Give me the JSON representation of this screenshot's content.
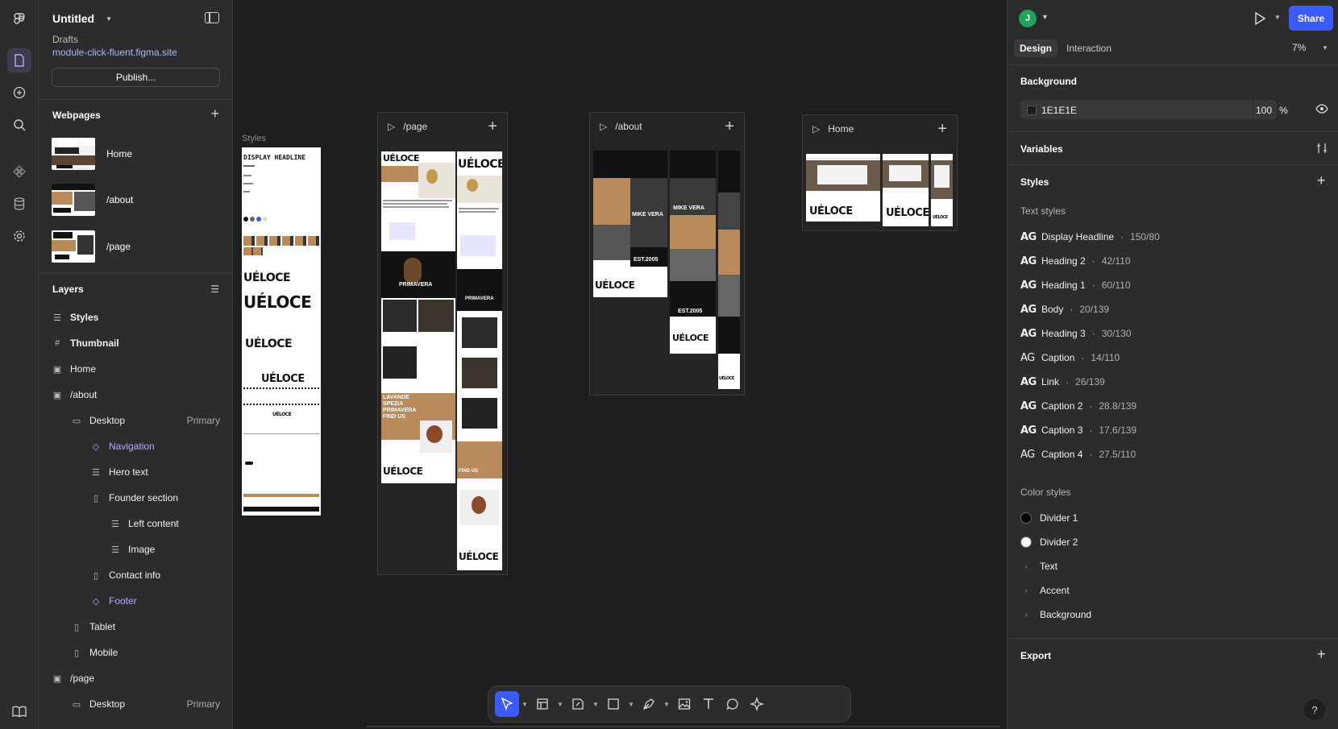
{
  "file": {
    "title": "Untitled",
    "drafts": "Drafts",
    "site": "module-click-fluent.figma.site",
    "publish_label": "Publish..."
  },
  "webpages": {
    "header": "Webpages",
    "items": [
      {
        "label": "Home"
      },
      {
        "label": "/about"
      },
      {
        "label": "/page"
      }
    ]
  },
  "layers": {
    "header": "Layers",
    "items": [
      {
        "label": "Styles"
      },
      {
        "label": "Thumbnail"
      },
      {
        "label": "Home"
      },
      {
        "label": "/about"
      },
      {
        "label": "Desktop",
        "badge": "Primary"
      },
      {
        "label": "Navigation"
      },
      {
        "label": "Hero text"
      },
      {
        "label": "Founder section"
      },
      {
        "label": "Left content"
      },
      {
        "label": "Image"
      },
      {
        "label": "Contact info"
      },
      {
        "label": "Footer"
      },
      {
        "label": "Tablet"
      },
      {
        "label": "Mobile"
      },
      {
        "label": "/page"
      },
      {
        "label": "Desktop",
        "badge": "Primary"
      }
    ]
  },
  "canvas": {
    "styles_label": "Styles",
    "styles_frame": {
      "headline": "DISPLAY HEADLINE"
    },
    "frames": [
      {
        "label": "/page"
      },
      {
        "label": "/about"
      },
      {
        "label": "Home"
      }
    ],
    "brand": "UÉLOCE",
    "est": "EST.2005",
    "hero_name": "MIKE VERA",
    "primavera": "PRIMAVERA",
    "find_us": "FIND US",
    "menu_words": [
      "LAVANDE",
      "SPEZIA",
      "PRIMAVERA"
    ]
  },
  "right": {
    "avatar_letter": "J",
    "share_label": "Share",
    "tabs": {
      "design": "Design",
      "interaction": "Interaction"
    },
    "zoom": "7%",
    "background": {
      "header": "Background",
      "hex": "1E1E1E",
      "opacity": "100",
      "unit": "%"
    },
    "variables": "Variables",
    "styles": {
      "header": "Styles",
      "text_header": "Text styles",
      "color_header": "Color styles"
    },
    "text_styles": [
      {
        "name": "Display Headline",
        "spec": "150/80"
      },
      {
        "name": "Heading 2",
        "spec": "42/110"
      },
      {
        "name": "Heading 1",
        "spec": "60/110"
      },
      {
        "name": "Body",
        "spec": "20/139"
      },
      {
        "name": "Heading 3",
        "spec": "30/130"
      },
      {
        "name": "Caption",
        "spec": "14/110"
      },
      {
        "name": "Link",
        "spec": "26/139"
      },
      {
        "name": "Caption 2",
        "spec": "28.8/139"
      },
      {
        "name": "Caption 3",
        "spec": "17.6/139"
      },
      {
        "name": "Caption 4",
        "spec": "27.5/110"
      }
    ],
    "color_styles": [
      {
        "name": "Divider 1",
        "color": "#000000"
      },
      {
        "name": "Divider 2",
        "color": "#ffffff"
      }
    ],
    "color_groups": [
      {
        "name": "Text"
      },
      {
        "name": "Accent"
      },
      {
        "name": "Background"
      }
    ],
    "export": "Export",
    "help": "?"
  },
  "colors": {
    "accent": "#3b5bff",
    "brand_tan": "#b98a5a",
    "canvas_bg": "#1e1e1e",
    "selected_purple": "#b9a8ff"
  }
}
